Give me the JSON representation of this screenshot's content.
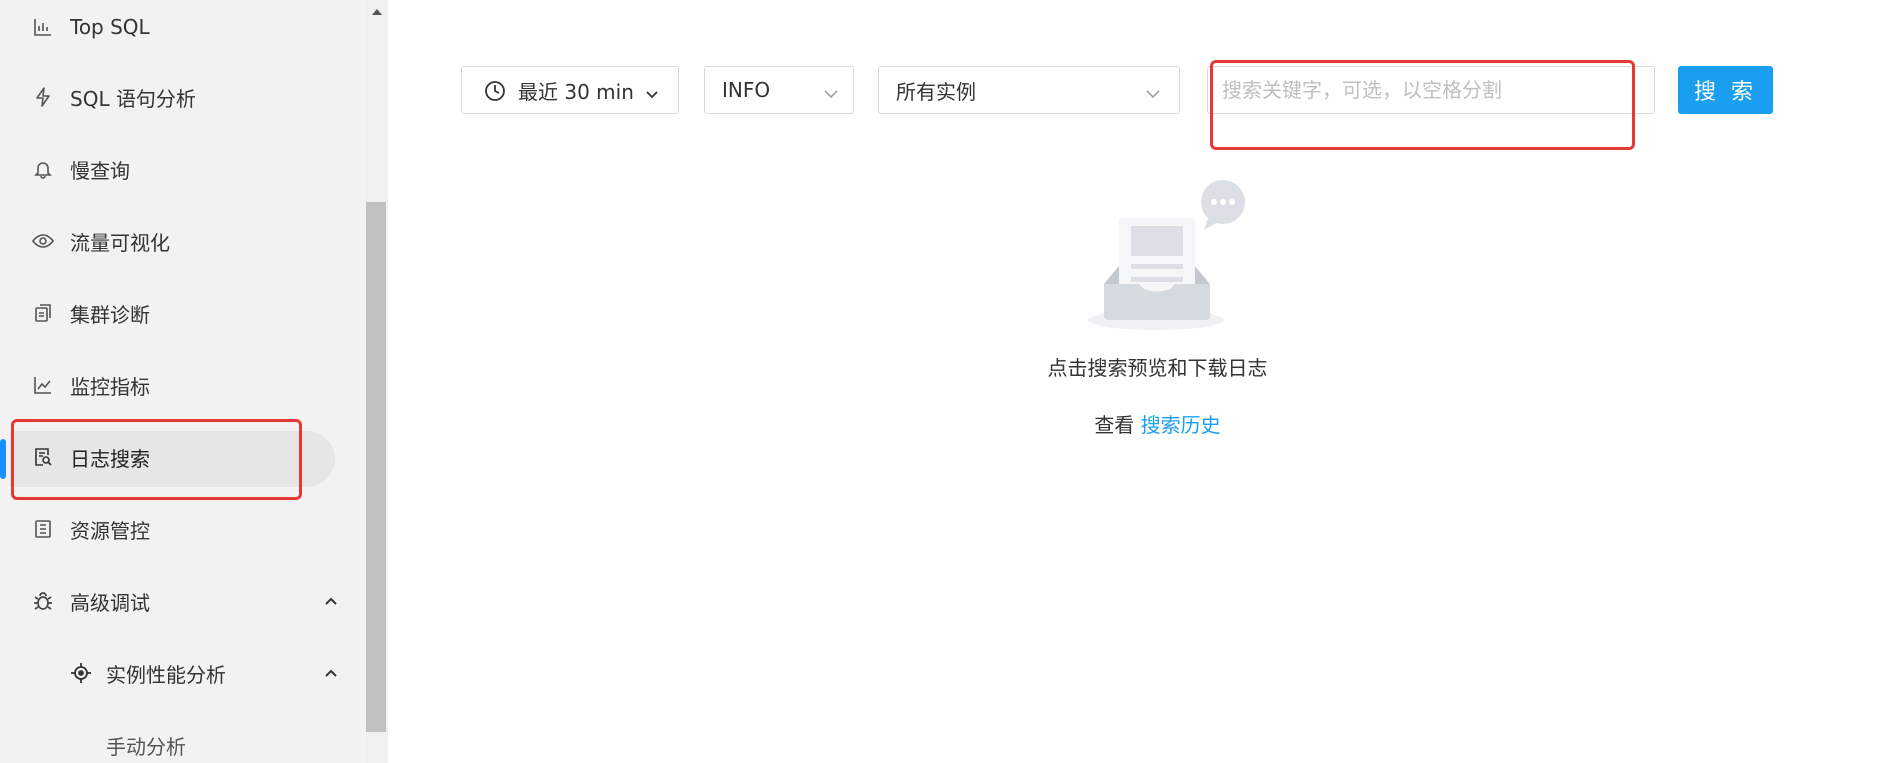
{
  "sidebar": {
    "items": [
      {
        "label": "Top SQL",
        "icon": "bar-chart-icon"
      },
      {
        "label": "SQL 语句分析",
        "icon": "lightning-icon"
      },
      {
        "label": "慢查询",
        "icon": "bell-icon"
      },
      {
        "label": "流量可视化",
        "icon": "eye-icon"
      },
      {
        "label": "集群诊断",
        "icon": "document-copy-icon"
      },
      {
        "label": "监控指标",
        "icon": "line-chart-icon"
      },
      {
        "label": "日志搜索",
        "icon": "file-search-icon",
        "active": true
      },
      {
        "label": "资源管控",
        "icon": "list-doc-icon"
      },
      {
        "label": "高级调试",
        "icon": "bug-icon",
        "expanded": true
      },
      {
        "label": "实例性能分析",
        "icon": "target-icon",
        "expanded": true
      },
      {
        "label": "手动分析"
      }
    ],
    "accent_color": "#1890ff"
  },
  "toolbar": {
    "time_range": "最近 30 min",
    "log_level": "INFO",
    "instance": "所有实例",
    "search_placeholder": "搜索关键字，可选，以空格分割",
    "search_button": "搜 索",
    "button_color": "#1a9ff0"
  },
  "empty_state": {
    "description": "点击搜索预览和下载日志",
    "history_prefix": "查看",
    "history_link": "搜索历史"
  },
  "annotation_color": "#e53935"
}
